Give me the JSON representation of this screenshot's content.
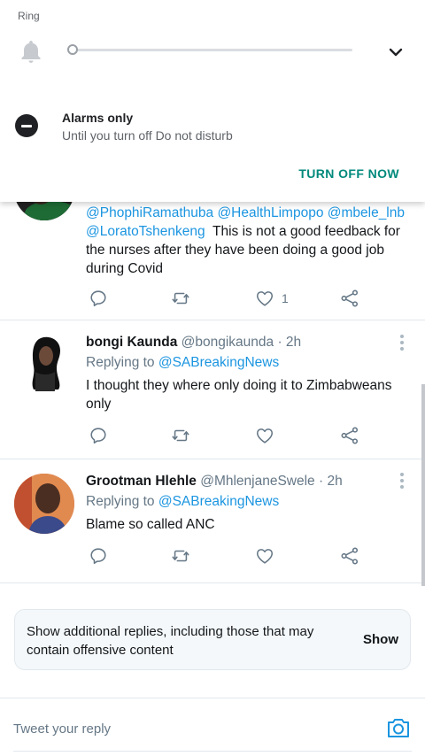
{
  "volume_panel": {
    "ring_label": "Ring",
    "icons": {
      "bell": "bell-icon",
      "expand": "chevron-down-icon"
    },
    "dnd": {
      "title": "Alarms only",
      "subtitle": "Until you turn off Do not disturb",
      "action": "TURN OFF NOW",
      "icon": "do-not-disturb-icon"
    },
    "accent_color": "#00897b"
  },
  "tweets": [
    {
      "author": "",
      "handle": "",
      "time": "",
      "replying_to": "",
      "text_mentions": "@PhophiRamathuba @HealthLimpopo @mbele_lnb @LoratoTshenkeng",
      "text": "This is not a good feedback for the nurses after they have been doing a good job during Covid",
      "likes": "1"
    },
    {
      "author": "bongi Kaunda",
      "handle": "@bongikaunda",
      "time": "· 2h",
      "replying_label": "Replying to",
      "replying_to": "@SABreakingNews",
      "text": "I thought they where only doing it to Zimbabweans only",
      "likes": ""
    },
    {
      "author": "Grootman Hlehle",
      "handle": "@MhlenjaneSwele",
      "time": "· 2h",
      "replying_label": "Replying to",
      "replying_to": "@SABreakingNews",
      "text": "Blame so called ANC",
      "likes": ""
    }
  ],
  "action_icons": [
    "reply-icon",
    "retweet-icon",
    "like-icon",
    "share-icon"
  ],
  "notice": {
    "text": "Show additional replies, including those that may contain offensive content",
    "button": "Show"
  },
  "composer": {
    "placeholder": "Tweet your reply",
    "icon": "camera-icon"
  },
  "colors": {
    "link": "#1b95e0",
    "muted": "#657786",
    "divider": "#e1e8ed"
  }
}
